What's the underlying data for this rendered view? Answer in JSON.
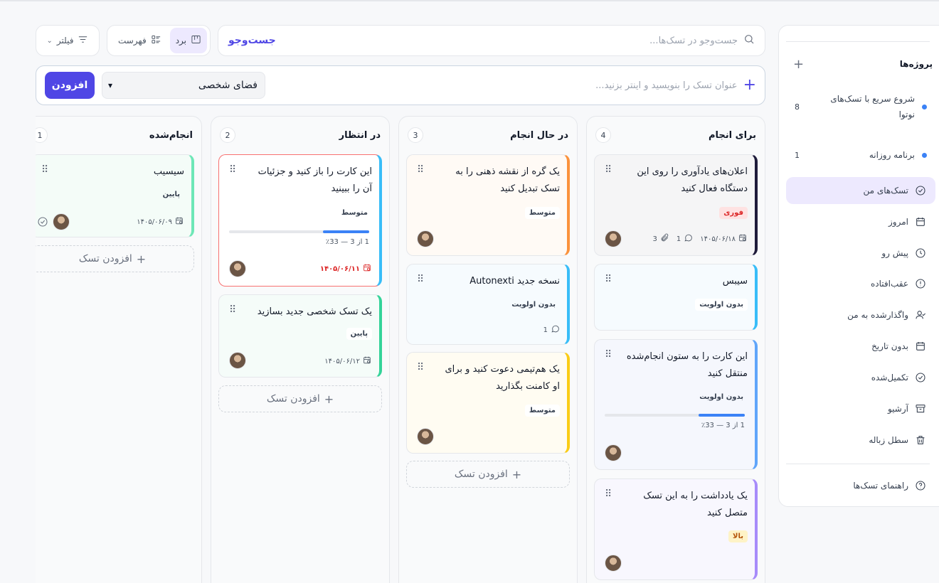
{
  "search": {
    "placeholder": "جست‌وجو در تسک‌ها...",
    "button": "جست‌وجو"
  },
  "view_switch": {
    "board": "برد",
    "list": "فهرست"
  },
  "filter": {
    "label": "فیلتر"
  },
  "quick_add": {
    "placeholder": "عنوان تسک را بنویسید و اینتر بزنید...",
    "workspace": "فضای شخصی",
    "add_button": "افزودن"
  },
  "sidebar": {
    "projects_title": "پروژه‌ها",
    "projects": [
      {
        "label": "شروع سریع با تسک‌های نوتوا",
        "count": "8"
      },
      {
        "label": "برنامه روزانه",
        "count": "1"
      }
    ],
    "items": [
      {
        "label": "تسک‌های من",
        "icon": "check-circle-icon"
      },
      {
        "label": "امروز",
        "icon": "calendar-icon"
      },
      {
        "label": "پیش رو",
        "icon": "clock-icon"
      },
      {
        "label": "عقب‌افتاده",
        "icon": "alert-circle-icon"
      },
      {
        "label": "واگذارشده به من",
        "icon": "user-check-icon"
      },
      {
        "label": "بدون تاریخ",
        "icon": "calendar-icon"
      },
      {
        "label": "تکمیل‌شده",
        "icon": "check-circle-icon"
      },
      {
        "label": "آرشیو",
        "icon": "archive-icon"
      },
      {
        "label": "سطل زباله",
        "icon": "trash-icon"
      }
    ],
    "help": "راهنمای تسک‌ها"
  },
  "columns": [
    {
      "name": "برای انجام",
      "count": "4",
      "cards": [
        {
          "title": "اعلان‌های یادآوری را روی این دستگاه فعال کنید",
          "priority": "فوری",
          "date": "۱۴۰۵/۰۶/۱۸",
          "comments": "1",
          "attachments": "3"
        },
        {
          "title": "سیبس",
          "priority": "بدون اولویت"
        },
        {
          "title": "این کارت را به ستون انجام‌شده منتقل کنید",
          "priority": "بدون اولویت",
          "progress_text": "1 از 3 — 33٪",
          "progress": 0.33
        },
        {
          "title": "یک یادداشت را به این تسک متصل کنید",
          "priority": "بالا"
        }
      ],
      "add": "افزودن تسک"
    },
    {
      "name": "در حال انجام",
      "count": "3",
      "cards": [
        {
          "title": "یک گره از نقشه ذهنی را به تسک تبدیل کنید",
          "priority": "متوسط"
        },
        {
          "title": "نسخه جدید Autonexti",
          "priority": "بدون اولویت",
          "comments": "1"
        },
        {
          "title": "یک هم‌تیمی دعوت کنید و برای او کامنت بگذارید",
          "priority": "متوسط"
        }
      ],
      "add": "افزودن تسک"
    },
    {
      "name": "در انتظار",
      "count": "2",
      "cards": [
        {
          "title": "این کارت را باز کنید و جزئیات آن را ببینید",
          "priority": "متوسط",
          "progress_text": "1 از 3 — 33٪",
          "progress": 0.33,
          "date": "۱۴۰۵/۰۶/۱۱"
        },
        {
          "title": "یک تسک شخصی جدید بسازید",
          "priority": "پایین",
          "date": "۱۴۰۵/۰۶/۱۲"
        }
      ],
      "add": "افزودن تسک"
    },
    {
      "name": "انجام‌شده",
      "count": "1",
      "cards": [
        {
          "title": "سیسیب",
          "priority": "پایین",
          "date": "۱۴۰۵/۰۶/۰۹"
        }
      ],
      "add": "افزودن تسک"
    }
  ],
  "colors": {
    "accent": "#4f46e5",
    "urgent": "#dc2626",
    "high": "#b45309",
    "blue": "#3b82f6",
    "overdue_card_border": "#f87171"
  }
}
